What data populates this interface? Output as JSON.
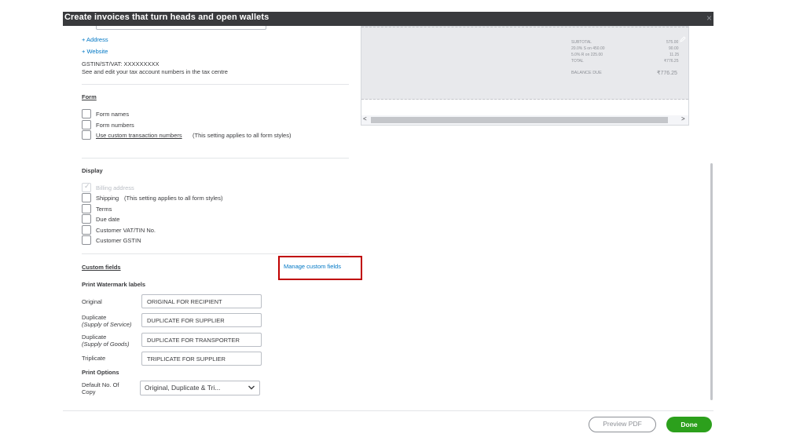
{
  "window": {
    "title": "Create invoices that turn heads and open wallets",
    "close_glyph": "×"
  },
  "company": {
    "add_address": "+ Address",
    "add_website": "+ Website",
    "tax_id": "GSTIN/ST/VAT: XXXXXXXXX",
    "tax_hint": "See and edit your tax account numbers in the tax centre"
  },
  "form_section": {
    "heading": "Form",
    "options": [
      {
        "label": "Form names",
        "checked": false
      },
      {
        "label": "Form numbers",
        "checked": false
      },
      {
        "label": "Use custom transaction numbers",
        "note": "(This setting applies to all form styles)",
        "checked": false
      }
    ]
  },
  "display_section": {
    "heading": "Display",
    "options": [
      {
        "label": "Billing address",
        "checked": true,
        "disabled": true
      },
      {
        "label": "Shipping",
        "note": "(This setting applies to all form styles)",
        "checked": false
      },
      {
        "label": "Terms",
        "checked": false
      },
      {
        "label": "Due date",
        "checked": false
      },
      {
        "label": "Customer VAT/TIN No.",
        "checked": false
      },
      {
        "label": "Customer GSTIN",
        "checked": false
      }
    ]
  },
  "custom_fields": {
    "heading": "Custom fields",
    "manage_link": "Manage custom fields"
  },
  "watermark": {
    "heading": "Print Watermark labels",
    "rows": [
      {
        "label": "Original",
        "sub": "",
        "value": "ORIGINAL FOR RECIPIENT"
      },
      {
        "label": "Duplicate",
        "sub": "(Supply of Service)",
        "value": "DUPLICATE FOR SUPPLIER"
      },
      {
        "label": "Duplicate",
        "sub": "(Supply of Goods)",
        "value": "DUPLICATE FOR TRANSPORTER"
      },
      {
        "label": "Triplicate",
        "sub": "",
        "value": "TRIPLICATE FOR SUPPLIER"
      }
    ]
  },
  "print_options": {
    "heading": "Print Options",
    "copy_label_line1": "Default No. Of",
    "copy_label_line2": "Copy",
    "copy_value": "Original, Duplicate & Tri..."
  },
  "preview": {
    "subtotal_label": "SUBTOTAL",
    "subtotal_value": "575.00",
    "tax1_label": "20.0% S on 450.00",
    "tax1_value": "90.00",
    "tax2_label": "5.0% R on 225.00",
    "tax2_value": "11.25",
    "total_label": "TOTAL",
    "total_value": "₹776.25",
    "balance_label": "BALANCE DUE",
    "balance_value": "₹776.25",
    "scroll_left": "<",
    "scroll_right": ">"
  },
  "footer": {
    "preview_pdf": "Preview PDF",
    "done": "Done"
  },
  "colors": {
    "titlebar": "#393a3d",
    "link": "#0077c5",
    "done_button": "#2ca01c",
    "highlight_box": "#c00000"
  }
}
